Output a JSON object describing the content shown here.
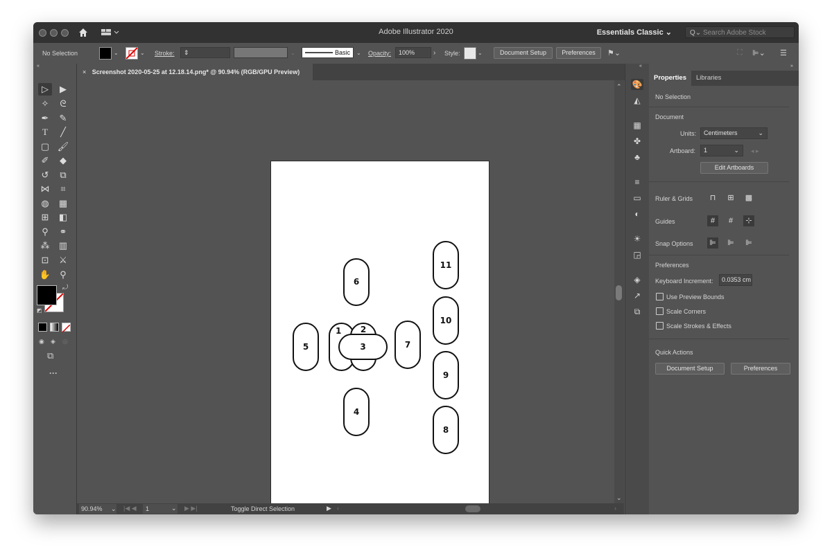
{
  "window": {
    "title": "Adobe Illustrator 2020",
    "workspace": "Essentials Classic",
    "search_placeholder": "Search Adobe Stock"
  },
  "control_bar": {
    "selection": "No Selection",
    "stroke_label": "Stroke:",
    "brush_label": "Basic",
    "opacity_label": "Opacity:",
    "opacity_value": "100%",
    "style_label": "Style:",
    "document_setup": "Document Setup",
    "preferences": "Preferences"
  },
  "document_tab": {
    "close": "×",
    "title": "Screenshot 2020-05-25 at 12.18.14.png* @ 90.94% (RGB/GPU Preview)"
  },
  "artboard_labels": [
    "1",
    "2",
    "3",
    "4",
    "5",
    "6",
    "7",
    "8",
    "9",
    "10",
    "11"
  ],
  "status_bar": {
    "zoom": "90.94%",
    "artboard": "1",
    "tool_hint": "Toggle Direct Selection"
  },
  "properties": {
    "tabs": [
      "Properties",
      "Libraries"
    ],
    "selection": "No Selection",
    "document_heading": "Document",
    "units_label": "Units:",
    "units_value": "Centimeters",
    "artboard_label": "Artboard:",
    "artboard_value": "1",
    "edit_artboards": "Edit Artboards",
    "ruler_grids": "Ruler & Grids",
    "guides": "Guides",
    "snap_options": "Snap Options",
    "preferences_heading": "Preferences",
    "keyboard_increment_label": "Keyboard Increment:",
    "keyboard_increment_value": "0.0353 cm",
    "checkboxes": [
      "Use Preview Bounds",
      "Scale Corners",
      "Scale Strokes & Effects"
    ],
    "quick_actions": "Quick Actions",
    "qa_document_setup": "Document Setup",
    "qa_preferences": "Preferences"
  },
  "colors": {
    "ui_bg": "#535353",
    "dark_bar": "#323232",
    "artboard": "#ffffff"
  }
}
